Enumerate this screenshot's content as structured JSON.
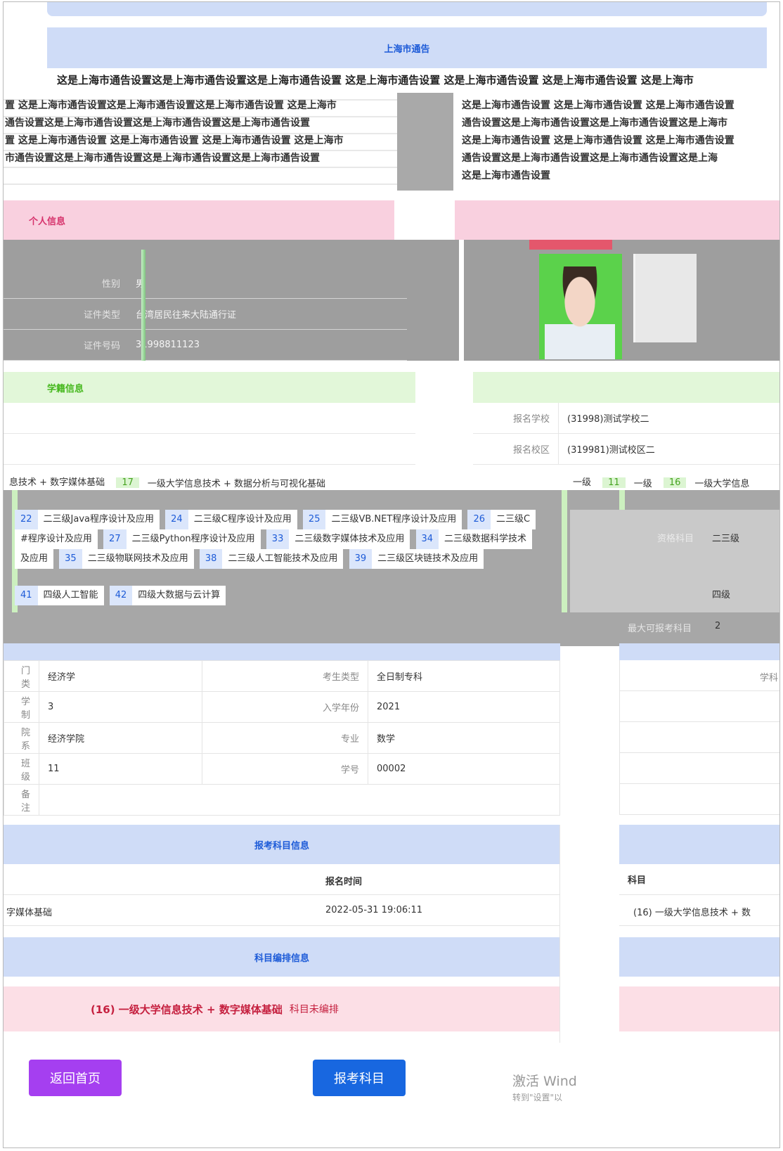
{
  "notice": {
    "title": "上海市通告",
    "line1": "这是上海市通告设置这是上海市通告设置这是上海市通告设置 这是上海市通告设置 这是上海市通告设置 这是上海市通告设置 这是上海市",
    "left_lines": [
      "置 这是上海市通告设置这是上海市通告设置这是上海市通告设置 这是上海市",
      "通告设置这是上海市通告设置这是上海市通告设置这是上海市通告设置",
      "置 这是上海市通告设置 这是上海市通告设置 这是上海市通告设置 这是上海市",
      "市通告设置这是上海市通告设置这是上海市通告设置这是上海市通告设置"
    ],
    "right_lines": [
      "这是上海市通告设置 这是上海市通告设置 这是上海市通告设置",
      "通告设置这是上海市通告设置这是上海市通告设置这是上海市",
      "这是上海市通告设置 这是上海市通告设置 这是上海市通告设置",
      "通告设置这是上海市通告设置这是上海市通告设置这是上海",
      "这是上海市通告设置"
    ]
  },
  "personal": {
    "title": "个人信息",
    "rows": [
      {
        "label": "性别",
        "value": "男"
      },
      {
        "label": "证件类型",
        "value": "台湾居民往来大陆通行证"
      },
      {
        "label": "证件号码",
        "value": "31998811123"
      }
    ]
  },
  "enrollment": {
    "title": "学籍信息",
    "school_label": "报名学校",
    "school_value": "(31998)测试学校二",
    "campus_label": "报名校区",
    "campus_value": "(319981)测试校区二"
  },
  "levels": {
    "line": [
      {
        "num": "",
        "name": "息技术 + 数字媒体基础"
      },
      {
        "num": "17",
        "name": "一级大学信息技术 + 数据分析与可视化基础"
      }
    ],
    "right_line": [
      {
        "num": "",
        "name": "一级"
      },
      {
        "num": "11",
        "name": "一级"
      },
      {
        "num": "16",
        "name": "一级大学信息"
      }
    ],
    "subjects_row1": [
      {
        "num": "22",
        "name": "二三级Java程序设计及应用"
      },
      {
        "num": "24",
        "name": "二三级C程序设计及应用"
      },
      {
        "num": "25",
        "name": "二三级VB.NET程序设计及应用"
      },
      {
        "num": "26",
        "name": "二三级C"
      }
    ],
    "subjects_row2": [
      {
        "num": "",
        "name": "#程序设计及应用"
      },
      {
        "num": "27",
        "name": "二三级Python程序设计及应用"
      },
      {
        "num": "33",
        "name": "二三级数字媒体技术及应用"
      },
      {
        "num": "34",
        "name": "二三级数据科学技术"
      }
    ],
    "subjects_row3": [
      {
        "num": "",
        "name": "及应用"
      },
      {
        "num": "35",
        "name": "二三级物联网技术及应用"
      },
      {
        "num": "38",
        "name": "二三级人工智能技术及应用"
      },
      {
        "num": "39",
        "name": "二三级区块链技术及应用"
      }
    ],
    "subjects_row4": [
      {
        "num": "41",
        "name": "四级人工智能"
      },
      {
        "num": "42",
        "name": "四级大数据与云计算"
      }
    ],
    "qual_label": "资格科目",
    "qual_v1": "二三级",
    "qual_v2": "四级",
    "max_label": "最大可报考科目",
    "max_value": "2"
  },
  "student": {
    "rows": [
      {
        "l1": "门类",
        "v1": "经济学",
        "l2": "考生类型",
        "v2": "全日制专科"
      },
      {
        "l1": "学制",
        "v1": "3",
        "l2": "入学年份",
        "v2": "2021"
      },
      {
        "l1": "院系",
        "v1": "经济学院",
        "l2": "专业",
        "v2": "数学"
      },
      {
        "l1": "班级",
        "v1": "11",
        "l2": "学号",
        "v2": "00002"
      }
    ],
    "remark_label": "备注",
    "right_label": "学科"
  },
  "apply": {
    "title": "报考科目信息",
    "time_header": "报名时间",
    "subject_fragment": "字媒体基础",
    "time_value": "2022-05-31 19:06:11",
    "right_header": "科目",
    "right_value": "(16) 一级大学信息技术 + 数"
  },
  "schedule": {
    "title": "科目编排信息",
    "subject": "(16) 一级大学信息技术 + 数字媒体基础",
    "state": "科目未编排"
  },
  "buttons": {
    "home": "返回首页",
    "apply": "报考科目"
  },
  "watermark": {
    "line1": "激活 Wind",
    "line2": "转到\"设置\"以"
  },
  "colors": {
    "accent_blue": "#1867e0",
    "accent_purple": "#a53ff0",
    "section_blue": "#cfdcf7",
    "section_pink": "#f9d0df",
    "section_green": "#e2f7d9"
  }
}
